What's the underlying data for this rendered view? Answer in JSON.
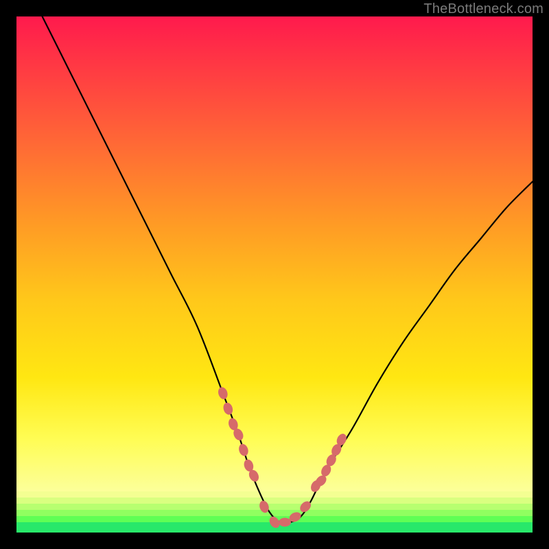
{
  "watermark": "TheBottleneck.com",
  "chart_data": {
    "type": "line",
    "title": "",
    "xlabel": "",
    "ylabel": "",
    "xlim": [
      0,
      100
    ],
    "ylim": [
      0,
      100
    ],
    "grid": false,
    "series": [
      {
        "name": "curve",
        "x": [
          5,
          10,
          15,
          20,
          25,
          30,
          35,
          40,
          43,
          45,
          47,
          49,
          51,
          53,
          55,
          57,
          60,
          65,
          70,
          75,
          80,
          85,
          90,
          95,
          100
        ],
        "values": [
          100,
          90,
          80,
          70,
          60,
          50,
          40,
          27,
          19,
          13,
          8,
          4,
          2,
          2,
          3,
          6,
          12,
          20,
          29,
          37,
          44,
          51,
          57,
          63,
          68
        ]
      }
    ],
    "markers": {
      "name": "highlight-dots",
      "color": "#d66a6a",
      "x": [
        40,
        41,
        42,
        43,
        44,
        45,
        46,
        48,
        50,
        52,
        54,
        56,
        58,
        59,
        60,
        61,
        62,
        63
      ],
      "values": [
        27,
        24,
        21,
        19,
        16,
        13,
        11,
        5,
        2,
        2,
        3,
        5,
        9,
        10,
        12,
        14,
        16,
        18
      ]
    }
  }
}
